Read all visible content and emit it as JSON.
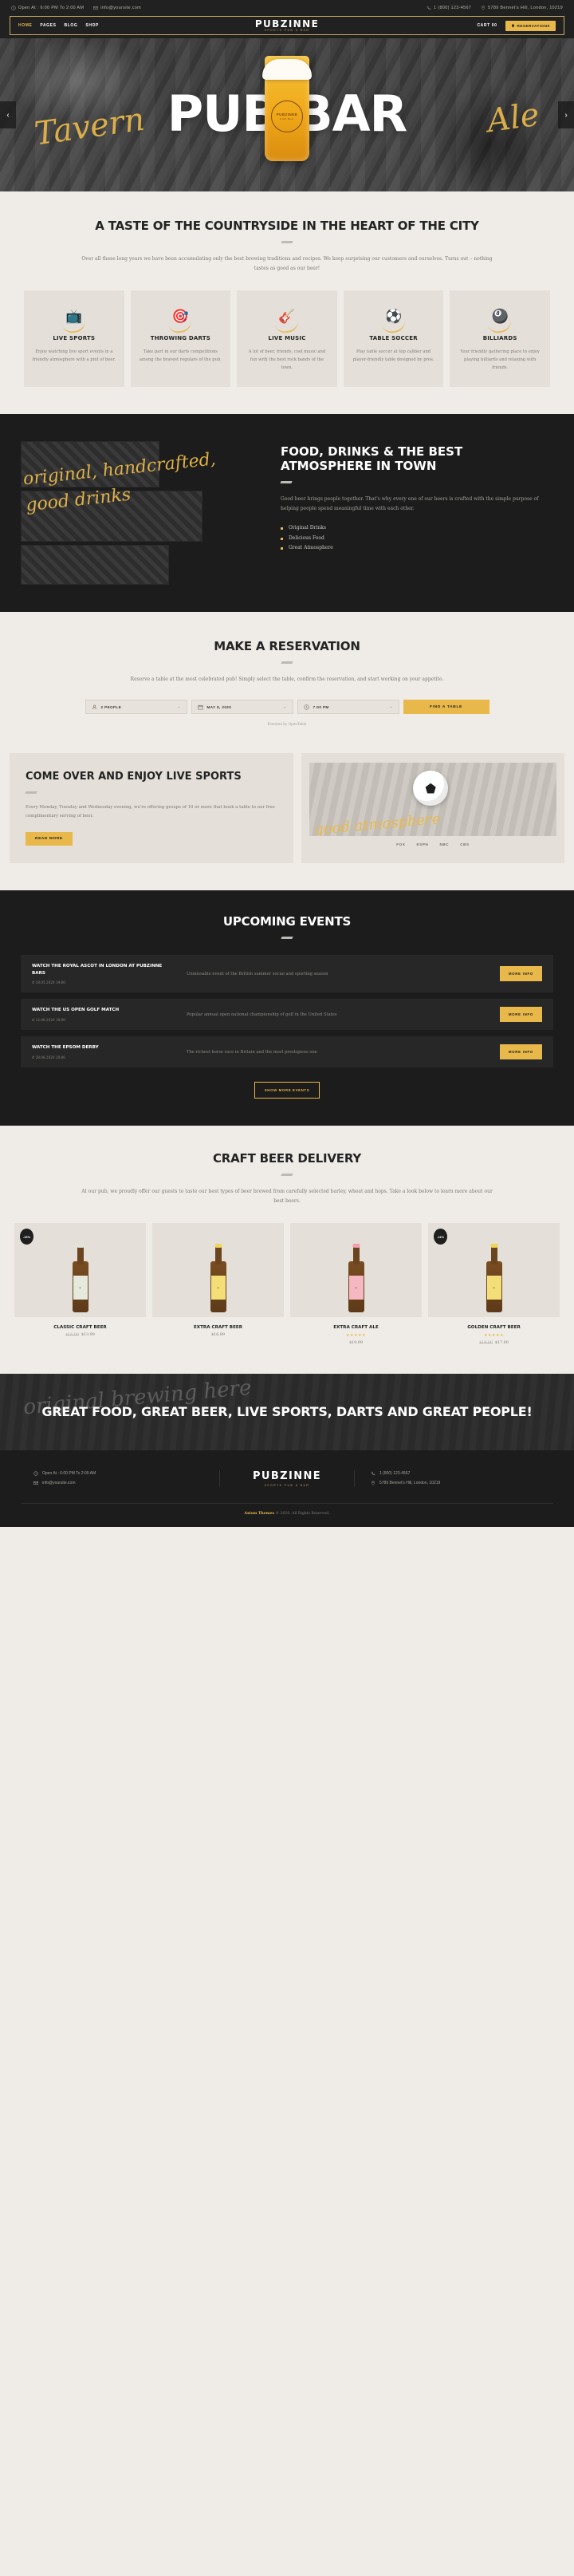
{
  "topbar": {
    "hours_icon": "clock-icon",
    "hours": "Open At : 6:00 PM To 2:00 AM",
    "email_icon": "envelope-icon",
    "email": "info@yoursite.com",
    "phone_icon": "phone-icon",
    "phone": "1 (800) 123-4567",
    "address_icon": "location-pin-icon",
    "address": "5789 Bennet's Hill, London, 10219"
  },
  "nav": {
    "items": [
      {
        "label": "HOME",
        "active": true
      },
      {
        "label": "PAGES",
        "active": false
      },
      {
        "label": "BLOG",
        "active": false
      },
      {
        "label": "SHOP",
        "active": false
      }
    ],
    "brand": "PUBZINNE",
    "brand_sub": "SPORTS PUB & BAR",
    "cart_label": "CART",
    "cart_count": "00",
    "cart_icon": "shopping-bag-icon",
    "reserve_label": "RESERVATIONS",
    "reserve_icon": "pin-icon"
  },
  "hero": {
    "title": "PUB BAR",
    "script_left": "Tavern",
    "script_right": "Ale",
    "glass_badge": "PUBZINNE",
    "glass_badge_sub": "Craft Beer",
    "prev_icon": "chevron-left-icon",
    "next_icon": "chevron-right-icon"
  },
  "about": {
    "title": "A TASTE OF THE COUNTRYSIDE IN THE HEART OF THE CITY",
    "text": "Over all these long years we have been accumulating only the best brewing traditions and recipes. We keep surprising our customers and ourselves. Turns out – nothing tastes as good as our beer!",
    "features": [
      {
        "icon": "tv-icon",
        "title": "LIVE SPORTS",
        "text": "Enjoy watching live sport events in a friendly atmosphere with a pint of beer."
      },
      {
        "icon": "dartboard-icon",
        "title": "THROWING DARTS",
        "text": "Take part in our darts competitions among the bravest regulars of the pub."
      },
      {
        "icon": "music-icon",
        "title": "LIVE MUSIC",
        "text": "A lot of beer, friends, cool music and fun with the best rock bands of the town."
      },
      {
        "icon": "foosball-icon",
        "title": "TABLE SOCCER",
        "text": "Play table soccer at top caliber and player-friendly table designed by pros."
      },
      {
        "icon": "billiards-icon",
        "title": "BILLIARDS",
        "text": "Your friendly gathering place to enjoy playing billiards and relaxing with friends."
      }
    ]
  },
  "food": {
    "script": "original, handcrafted, good drinks",
    "title": "FOOD, DRINKS & THE BEST ATMOSPHERE IN TOWN",
    "text": "Good beer brings people together. That's why every one of our beers is crafted with the simple purpose of helping people spend meaningful time with each other.",
    "bullets": [
      "Original Drinks",
      "Delicious Food",
      "Great Atmosphere"
    ]
  },
  "reservation": {
    "title": "MAKE A RESERVATION",
    "text": "Reserve a table at the most celebrated pub! Simply select the table, confirm the reservation, and start working on your appetite.",
    "fields": [
      {
        "icon": "person-icon",
        "value": "2 PEOPLE",
        "caret": "chevron-down-icon"
      },
      {
        "icon": "calendar-icon",
        "value": "MAY 8, 2020",
        "caret": "chevron-down-icon"
      },
      {
        "icon": "clock-icon",
        "value": "7:00 PM",
        "caret": "chevron-down-icon"
      }
    ],
    "submit_label": "FIND A TABLE",
    "powered_by": "Powered by OpenTable"
  },
  "sports": {
    "title": "COME OVER AND ENJOY LIVE SPORTS",
    "text": "Every Monday, Tuesday and Wednesday evening, we're offering groups of 10 or more that book a table to our free complimentary serving of beer.",
    "button_label": "READ MORE",
    "script": "good atmosphere",
    "logos": [
      "FOX",
      "ESPN",
      "NBC",
      "CBS"
    ]
  },
  "events": {
    "title": "UPCOMING EVENTS",
    "items": [
      {
        "title": "WATCH THE ROYAL ASCOT IN LONDON AT PUBZINNE BARS",
        "meta": "⏱ 18.05.2020 19:00",
        "desc": "Unmissable event of the British summer social and sporting season",
        "button": "MORE INFO"
      },
      {
        "title": "WATCH THE US OPEN GOLF MATCH",
        "meta": "⏱ 12.06.2020 18:00",
        "desc": "Popular annual open national championship of golf in the United States",
        "button": "MORE INFO"
      },
      {
        "title": "WATCH THE EPSOM DERBY",
        "meta": "⏱ 28.06.2020 20:00",
        "desc": "The richest horse race in Britain and the most prestigious one",
        "button": "MORE INFO"
      }
    ],
    "more_label": "SHOW MORE EVENTS"
  },
  "shop": {
    "title": "CRAFT BEER DELIVERY",
    "text": "At our pub, we proudly offer our guests to taste our best types of beer brewed from carefully selected barley, wheat and hops. Take a look below to learn more about our best beers.",
    "products": [
      {
        "name": "CLASSIC CRAFT BEER",
        "sale_badge": "-16%",
        "old_price": "$16.00",
        "price": "$13.99",
        "stars": "",
        "cap": "#dfe4d6"
      },
      {
        "name": "EXTRA CRAFT BEER",
        "sale_badge": "",
        "old_price": "",
        "price": "$16.99",
        "stars": "",
        "cap": "#f0d45c"
      },
      {
        "name": "EXTRA CRAFT ALE",
        "sale_badge": "",
        "old_price": "",
        "price": "$19.99",
        "stars": "★★★★★",
        "cap": "#f2a0ab"
      },
      {
        "name": "GOLDEN CRAFT BEER",
        "sale_badge": "-11%",
        "old_price": "$19.00",
        "price": "$17.00",
        "stars": "★★★★★",
        "cap": "#f0d45c"
      }
    ]
  },
  "cta": {
    "script": "original brewing here",
    "title": "GREAT FOOD, GREAT BEER, LIVE SPORTS, DARTS AND GREAT PEOPLE!"
  },
  "footer": {
    "hours_icon": "clock-icon",
    "hours": "Open At : 6:00 PM To 2:00 AM",
    "email_icon": "envelope-icon",
    "email": "info@yoursite.com",
    "brand": "PUBZINNE",
    "brand_sub": "SPORTS PUB & BAR",
    "phone_icon": "phone-icon",
    "phone": "1 (800) 123-4567",
    "address_icon": "location-pin-icon",
    "address": "5789 Bennet's Hill, London, 10219",
    "copyright_pre": "Axiom Themes",
    "copyright_post": "© 2020. All Rights Reserved."
  },
  "colors": {
    "gold": "#e8b84b",
    "dark": "#1c1c1c",
    "cream": "#efece7",
    "card": "#e4e0d9"
  }
}
